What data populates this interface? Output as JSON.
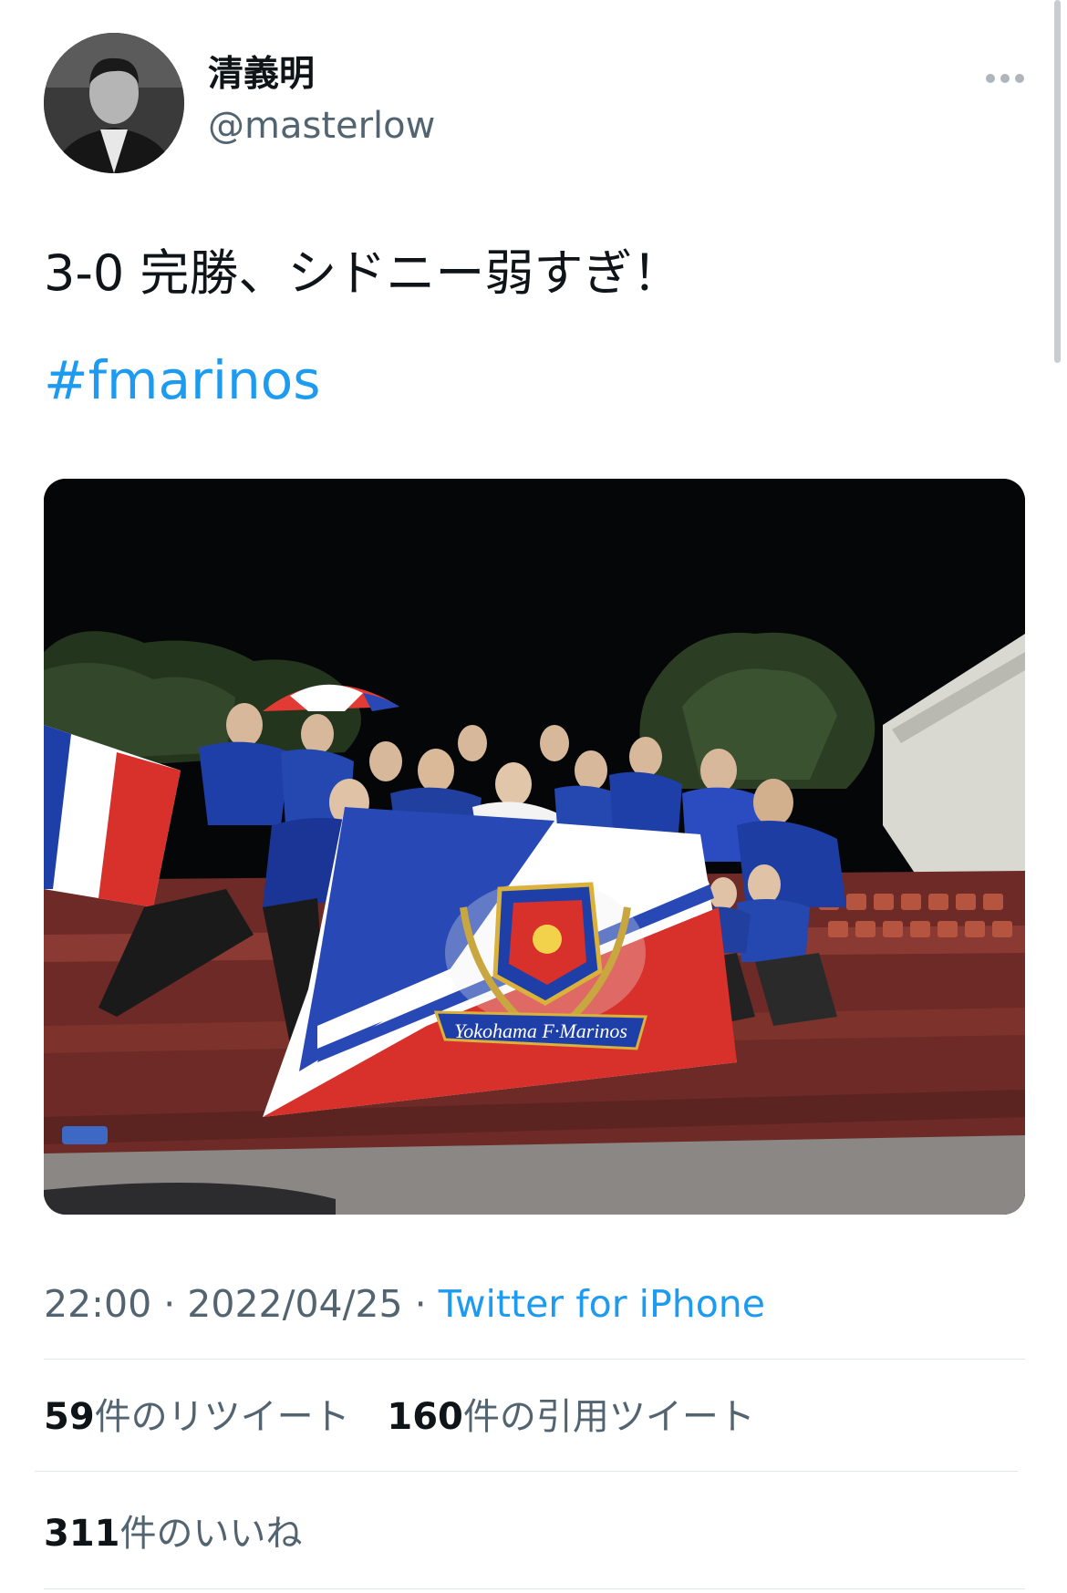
{
  "tweet": {
    "display_name": "清義明",
    "handle": "@masterlow",
    "text": "3-0 完勝、シドニー弱すぎ！",
    "hashtag": "#fmarinos",
    "photo_flag_text": "Yokohama F·Marinos",
    "time": "22:00",
    "separator": "·",
    "date": "2022/04/25",
    "source": "Twitter for iPhone"
  },
  "stats": {
    "retweets_count": "59",
    "retweets_label": "件のリツイート",
    "quotes_count": "160",
    "quotes_label": "件の引用ツイート",
    "likes_count": "311",
    "likes_label": "件のいいね"
  },
  "icons": {
    "more": "more-horizontal-icon"
  },
  "colors": {
    "link": "#1d9bf0",
    "secondary_text": "#536471",
    "primary_text": "#0f1419"
  }
}
